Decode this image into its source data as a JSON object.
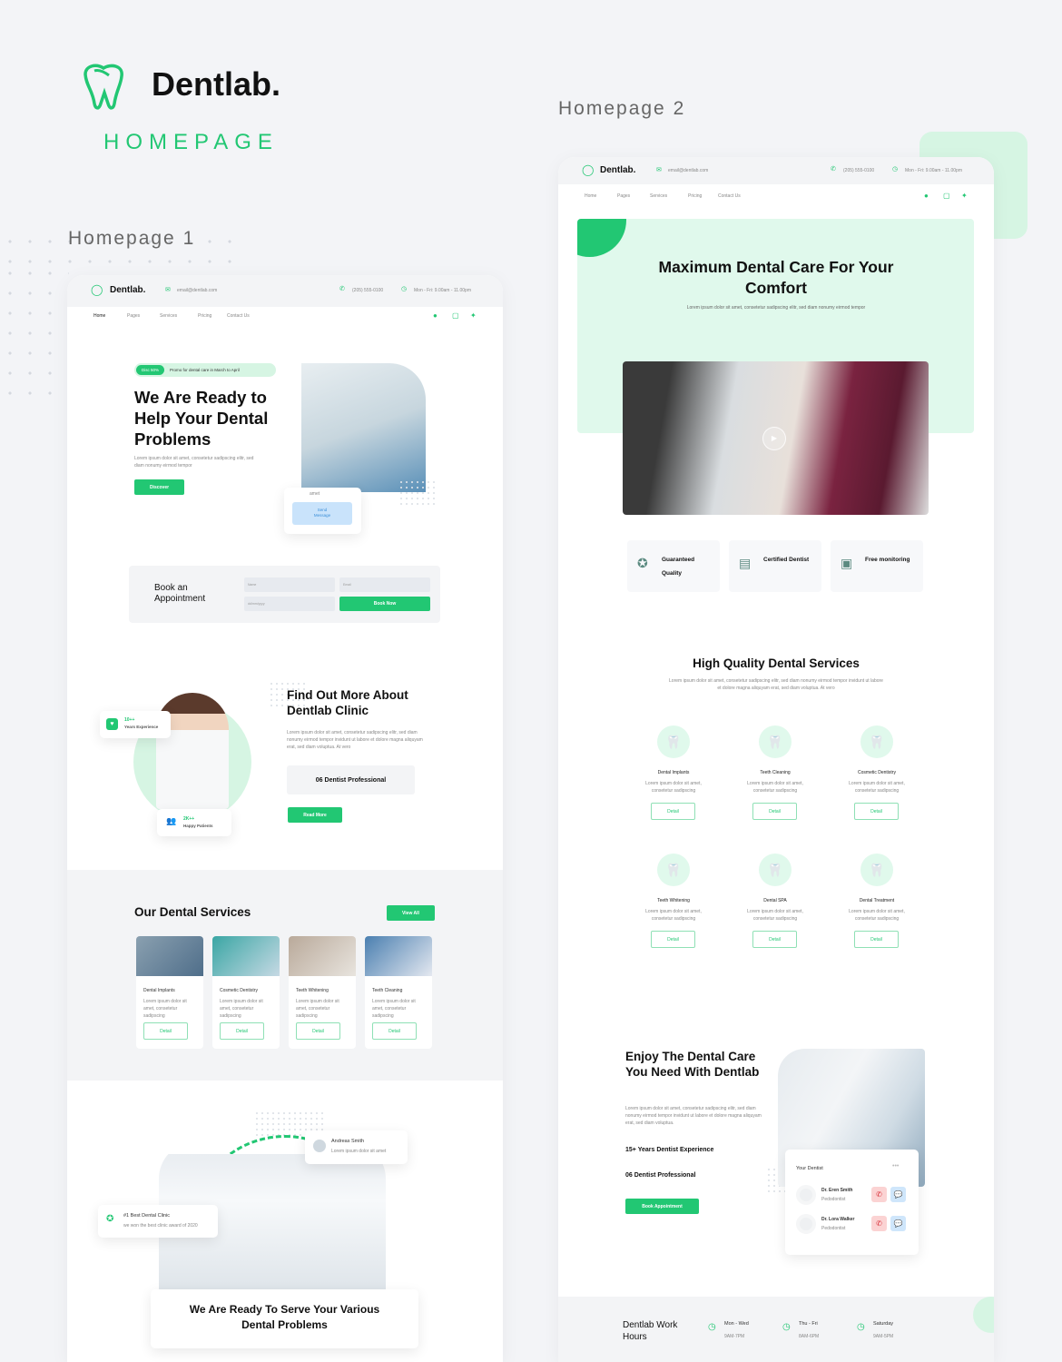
{
  "brand": {
    "name": "Dentlab.",
    "subtitle": "HOMEPAGE",
    "accent": "#22c773",
    "light_accent": "#e0f9ec"
  },
  "labels": {
    "homepage1": "Homepage 1",
    "homepage2": "Homepage 2"
  },
  "topbar": {
    "logo": "Dentlab.",
    "email": "email@dentlab.com",
    "phone": "(205) 555-0100",
    "hours": "Mon - Fri: 9.00am - 11.00pm"
  },
  "nav": {
    "items": [
      "Home",
      "Pages",
      "Services",
      "Pricing",
      "Contact Us"
    ],
    "social": [
      "facebook-icon",
      "instagram-icon",
      "twitter-icon"
    ]
  },
  "hp1": {
    "promo_badge": "Disc 50%",
    "promo_text": "Promo for dental care in March to April",
    "hero_title": [
      "We Are Ready to",
      "Help Your Dental",
      "Problems"
    ],
    "hero_text": "Lorem ipsum dolor sit amet, consetetur sadipscing elitr, sed diam nonumy eirmod tempor",
    "discover": "Discover",
    "send_message": "Send Message",
    "msg_snippet": "amet",
    "booking": {
      "title": "Book an Appointment",
      "name_placeholder": "Name",
      "email_placeholder": "Email",
      "date_placeholder": "dd/mm/yyyy",
      "submit": "Book Now"
    },
    "about": {
      "title": "Find Out More About Dentlab Clinic",
      "text": "Lorem ipsum dolor sit amet, consetetur sadipscing elitr, sed diam nonumy eirmod tempor invidunt ut labore et dolore magna aliquyam erat, sed diam voluptua. At vero",
      "stat_box": "06 Dentist Professional",
      "read_more": "Read More",
      "exp_value": "10++",
      "exp_label": "Years Experience",
      "patients_value": "2K++",
      "patients_label": "Happy Patients"
    },
    "services": {
      "title": "Our Dental Services",
      "view_all": "View All",
      "items": [
        {
          "title": "Dental Implants",
          "text": "Lorem ipsum dolor sit amet, consetetur sadipscing",
          "button": "Detail"
        },
        {
          "title": "Cosmetic Dentistry",
          "text": "Lorem ipsum dolor sit amet, consetetur sadipscing",
          "button": "Detail"
        },
        {
          "title": "Teeth Whitening",
          "text": "Lorem ipsum dolor sit amet, consetetur sadipscing",
          "button": "Detail"
        },
        {
          "title": "Teeth Cleaning",
          "text": "Lorem ipsum dolor sit amet, consetetur sadipscing",
          "button": "Detail"
        }
      ]
    },
    "team": {
      "review_name": "Andreas Smith",
      "review_text": "Lorem ipsum dolor sit amet",
      "award_title": "#1 Best Dental Clinic",
      "award_text": "we won the best clinic award of 2020",
      "title": "We Are Ready To Serve Your Various Dental Problems"
    }
  },
  "hp2": {
    "hero_title": "Maximum Dental Care For Your Comfort",
    "hero_text": "Lorem ipsum dolor sit amet, consetetur sadipscing elitr, sed diam nonumy eirmod tempor",
    "features": [
      {
        "label": "Guaranteed Quality",
        "icon": "badge-thumb-icon"
      },
      {
        "label": "Certified Dentist",
        "icon": "certificate-icon"
      },
      {
        "label": "Free monitoring",
        "icon": "monitor-icon"
      }
    ],
    "services": {
      "title": "High Quality Dental Services",
      "text": "Lorem ipsum dolor sit amet, consetetur sadipscing elitr, sed diam nonumy eirmod tempor invidunt ut labore et dolore magna aliquyam erat, sed diam voluptua. At vero",
      "items": [
        {
          "title": "Dental Implants",
          "text": "Lorem ipsum dolor sit amet, consetetur sadipscing",
          "button": "Detail"
        },
        {
          "title": "Teeth Cleaning",
          "text": "Lorem ipsum dolor sit amet, consetetur sadipscing",
          "button": "Detail"
        },
        {
          "title": "Cosmetic Dentistry",
          "text": "Lorem ipsum dolor sit amet, consetetur sadipscing",
          "button": "Detail"
        },
        {
          "title": "Teeth Whitening",
          "text": "Lorem ipsum dolor sit amet, consetetur sadipscing",
          "button": "Detail"
        },
        {
          "title": "Dental SPA",
          "text": "Lorem ipsum dolor sit amet, consetetur sadipscing",
          "button": "Detail"
        },
        {
          "title": "Dental Treatment",
          "text": "Lorem ipsum dolor sit amet, consetetur sadipscing",
          "button": "Detail"
        }
      ]
    },
    "enjoy": {
      "title": "Enjoy The Dental Care You Need With Dentlab",
      "text": "Lorem ipsum dolor sit amet, consetetur sadipscing elitr, sed diam nonumy eirmod tempor invidunt ut labore et dolore magna aliquyam erat, sed diam voluptua.",
      "stat1": "15+ Years Dentist Experience",
      "stat2": "06 Dentist Professional",
      "button": "Book Appointment"
    },
    "dentists": {
      "title": "Your Dentist",
      "items": [
        {
          "name": "Dr. Eren Smith",
          "role": "Pedodontist"
        },
        {
          "name": "Dr. Lora Walker",
          "role": "Pedodontist"
        }
      ]
    },
    "hours": {
      "title": "Dentlab Work Hours",
      "items": [
        {
          "days": "Mon - Wed",
          "time": "9AM-7PM"
        },
        {
          "days": "Thu - Fri",
          "time": "8AM-6PM"
        },
        {
          "days": "Saturday",
          "time": "9AM-5PM"
        }
      ]
    }
  }
}
